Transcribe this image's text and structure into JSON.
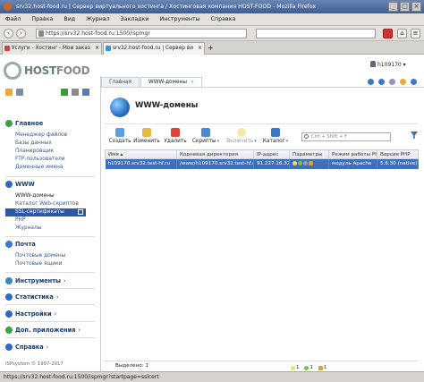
{
  "window": {
    "title": "srv32.host-food.ru | Сервер виртуального хостинга / Хостинговая компания HOST-FOOD - Mozilla Firefox"
  },
  "menu": [
    "Файл",
    "Правка",
    "Вид",
    "Журнал",
    "Закладки",
    "Инструменты",
    "Справка"
  ],
  "browser": {
    "url": "https://srv32.host-food.ru:1500/ispmgr",
    "tabs": [
      {
        "label": "Услуги - Хостинг - Мои заказ"
      },
      {
        "label": "srv32.host-food.ru | Сервер ви"
      }
    ],
    "status": "https://srv32.host-food.ru:1500/ispmgr?startpage=sslcert"
  },
  "brand": {
    "host": "HOST",
    "food": "FOOD"
  },
  "user": {
    "name": "h109170"
  },
  "nav": {
    "main": {
      "label": "Главное",
      "items": [
        "Менеджер файлов",
        "Базы данных",
        "Планировщик",
        "FTP-пользователи",
        "Доменные имена"
      ]
    },
    "www": {
      "label": "WWW",
      "items": [
        "WWW-домены",
        "Каталог Web-скриптов",
        "SSL-сертификаты",
        "PHP",
        "Журналы"
      ]
    },
    "mail": {
      "label": "Почта",
      "items": [
        "Почтовые домены",
        "Почтовые ящики"
      ]
    },
    "collapsed": [
      "Инструменты",
      "Статистика",
      "Настройки",
      "Доп. приложения",
      "Справка"
    ]
  },
  "copyright": "ISPsystem © 1997-2017",
  "panel_tabs": [
    {
      "label": "Главная"
    },
    {
      "label": "WWW-домены"
    }
  ],
  "page": {
    "title": "WWW-домены"
  },
  "toolbar": {
    "create": "Создать",
    "edit": "Изменить",
    "delete": "Удалить",
    "scripts": "Скрипты",
    "enable": "Включить",
    "catalog": "Каталог",
    "filter_placeholder": "Ctrl + Shift + F"
  },
  "table": {
    "headers": [
      "Имя",
      "Корневая директория",
      "IP-адрес",
      "Параметры",
      "Режим работы PHP",
      "Версия PHP"
    ],
    "rows": [
      {
        "name": "h109170.srv32.test-hf.ru",
        "root": "/www/h109170.srv32.test-hf.ru",
        "ip": "91.227.16.32",
        "php_mode": "модуль Apache",
        "php_version": "5.6.30 (native)"
      }
    ]
  },
  "footer": {
    "selected": "Выделено: 1",
    "counts": [
      "1",
      "1",
      "1"
    ]
  },
  "colors": {
    "accent": "#2d58a8",
    "selected_row": "#3f6fb6",
    "header_bar": "#3d5d92"
  }
}
